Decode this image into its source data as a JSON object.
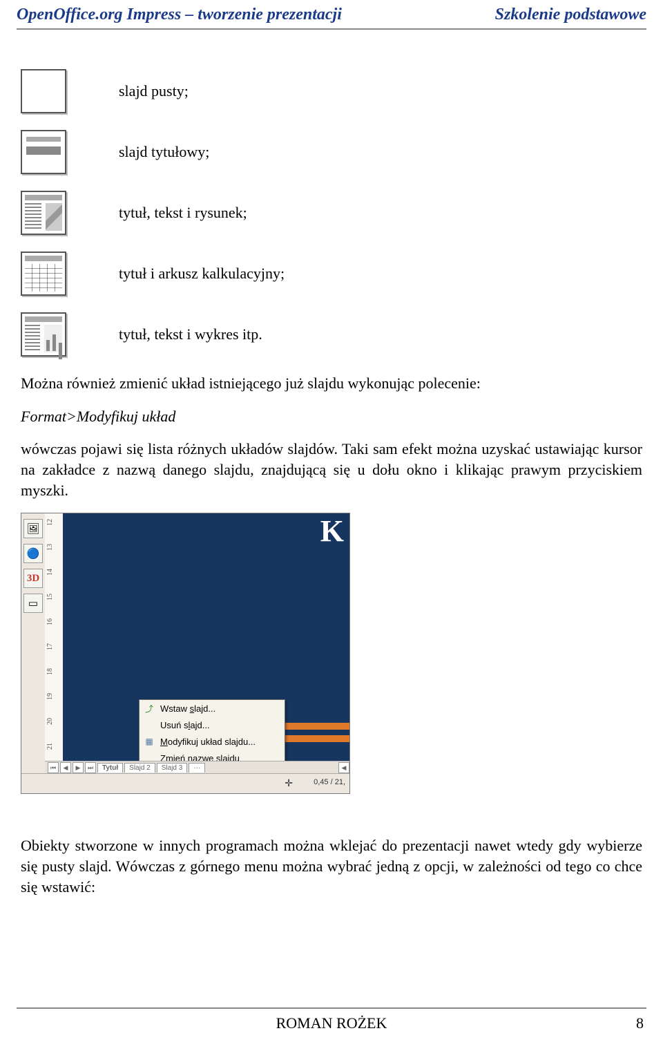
{
  "header": {
    "left": "OpenOffice.org Impress – tworzenie prezentacji",
    "right": "Szkolenie podstawowe"
  },
  "layouts": [
    {
      "label": "slajd pusty;"
    },
    {
      "label": "slajd tytułowy;"
    },
    {
      "label": "tytuł, tekst i rysunek;"
    },
    {
      "label": "tytuł i arkusz kalkulacyjny;"
    },
    {
      "label": "tytuł, tekst i wykres itp."
    }
  ],
  "para1": "Można również zmienić układ istniejącego już slajdu wykonując polecenie:",
  "menu_path": "Format>Modyfikuj układ",
  "para2": "wówczas pojawi się lista różnych układów slajdów. Taki sam efekt można uzyskać ustawiając kursor na zakładce z nazwą danego slajdu, znajdującą się u dołu okno i klikając prawym przyciskiem myszki.",
  "screenshot": {
    "big_letter": "K",
    "ruler_numbers": [
      "12",
      "13",
      "14",
      "15",
      "16",
      "17",
      "18",
      "19",
      "20",
      "21"
    ],
    "context_menu": [
      {
        "icon": "⤴",
        "label_pre": "Wstaw ",
        "mnemonic": "s",
        "label_post": "lajd..."
      },
      {
        "icon": "",
        "label_pre": "Usuń s",
        "mnemonic": "l",
        "label_post": "ajd..."
      },
      {
        "icon": "▦",
        "label_pre": "",
        "mnemonic": "M",
        "label_post": "odyfikuj układ slajdu..."
      },
      {
        "icon": "",
        "label_pre": "",
        "mnemonic": "Z",
        "label_post": "mień nazwę slajdu"
      }
    ],
    "tabs": {
      "active": "Tytuł",
      "others": [
        "Slajd 2",
        "Slajd 3"
      ],
      "more": "···"
    },
    "status_coord": "0,45 / 21,",
    "status_cross": "✛"
  },
  "para3": "Obiekty stworzone w innych programach można wklejać do prezentacji nawet wtedy gdy wybierze się pusty slajd. Wówczas z górnego menu można wybrać jedną z opcji, w zależności od tego co chce się wstawić:",
  "footer": {
    "author": "ROMAN ROŻEK",
    "page": "8"
  }
}
